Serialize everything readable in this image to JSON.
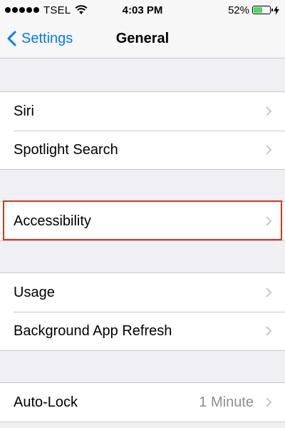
{
  "status_bar": {
    "carrier": "TSEL",
    "time": "4:03 PM",
    "battery_percent": "52%",
    "battery_level": 0.52,
    "icons": [
      "signal-dots-icon",
      "wifi-icon",
      "battery-icon",
      "charging-bolt-icon"
    ]
  },
  "nav": {
    "back_label": "Settings",
    "title": "General"
  },
  "groups": [
    [
      {
        "label": "Siri",
        "value": ""
      },
      {
        "label": "Spotlight Search",
        "value": ""
      }
    ],
    [
      {
        "label": "Accessibility",
        "value": ""
      }
    ],
    [
      {
        "label": "Usage",
        "value": ""
      },
      {
        "label": "Background App Refresh",
        "value": ""
      }
    ],
    [
      {
        "label": "Auto-Lock",
        "value": "1 Minute"
      }
    ]
  ],
  "colors": {
    "accent": "#007aff",
    "highlight": "#e0301e",
    "battery_fill": "#4cd964"
  }
}
